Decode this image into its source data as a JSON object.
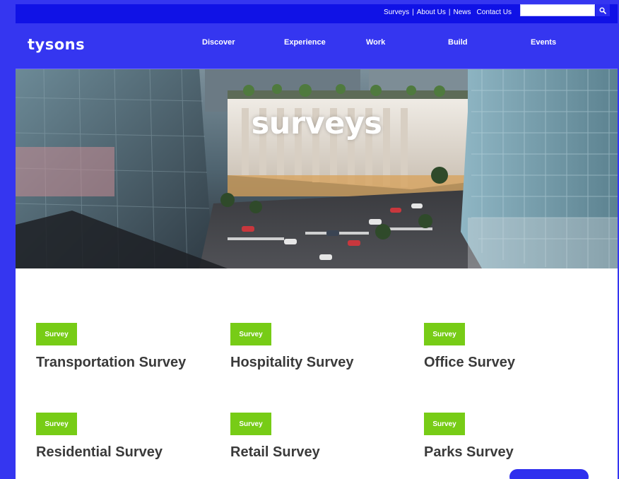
{
  "utility_nav": {
    "links": [
      "Surveys",
      "About Us",
      "News",
      "Contact Us"
    ],
    "search_placeholder": ""
  },
  "main_nav": {
    "logo": "Tysons",
    "items": [
      "Discover",
      "Experience",
      "Work",
      "Build",
      "Events"
    ]
  },
  "hero": {
    "title": "surveys"
  },
  "surveys": [
    {
      "badge": "Survey",
      "title": "Transportation Survey"
    },
    {
      "badge": "Survey",
      "title": "Hospitality Survey"
    },
    {
      "badge": "Survey",
      "title": "Office Survey"
    },
    {
      "badge": "Survey",
      "title": "Residential Survey"
    },
    {
      "badge": "Survey",
      "title": "Retail Survey"
    },
    {
      "badge": "Survey",
      "title": "Parks Survey"
    }
  ],
  "colors": {
    "brand_blue": "#3536f0",
    "utility_blue": "#1012e6",
    "badge_green": "#77cc16",
    "title_gray": "#3a3a3a"
  }
}
